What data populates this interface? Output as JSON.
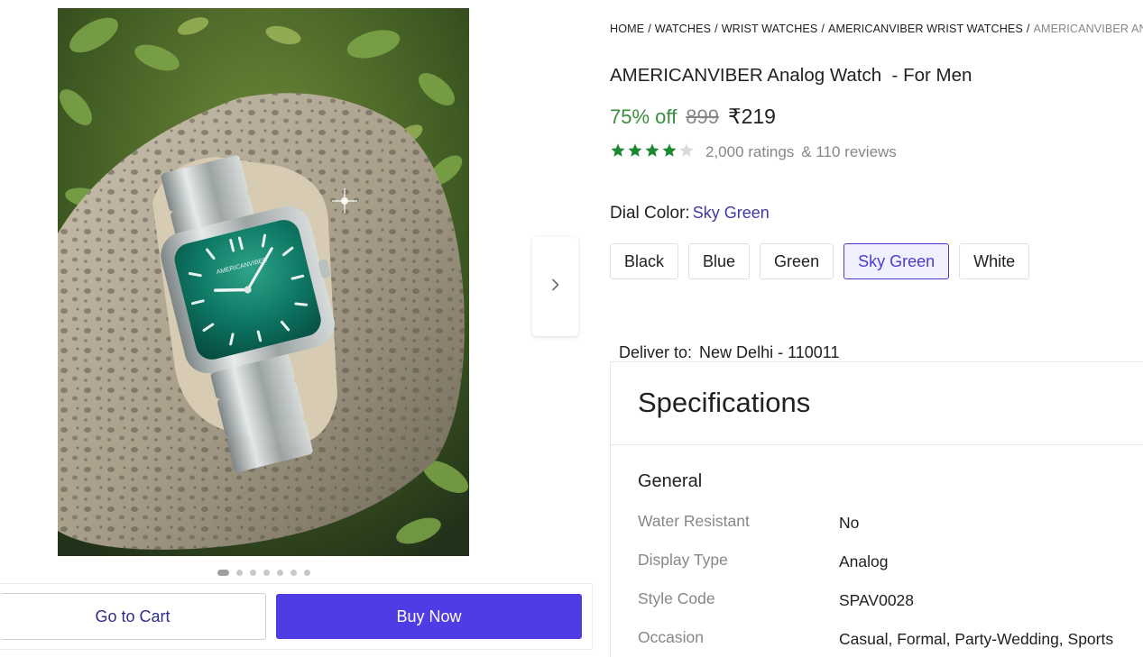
{
  "breadcrumb": [
    "HOME",
    "WATCHES",
    "WRIST WATCHES",
    "AMERICANVIBER WRIST WATCHES",
    "AMERICANVIBER ANALOG WATCH - FOR MEN"
  ],
  "product": {
    "title": "AMERICANVIBER Analog Watch  - For Men",
    "image_brand_text": "AMERICANVIBER",
    "discount": "75% off",
    "mrp": "899",
    "price": "₹219",
    "rating_stars": 4,
    "ratings_text": "2,000 ratings",
    "reviews_text": "& 110 reviews"
  },
  "dial_color": {
    "label": "Dial Color:",
    "selected": "Sky Green",
    "options": [
      "Black",
      "Blue",
      "Green",
      "Sky Green",
      "White"
    ]
  },
  "delivery": {
    "label": "Deliver to:",
    "location": "New Delhi - 110011"
  },
  "specifications": {
    "title": "Specifications",
    "group": "General",
    "rows": [
      {
        "key": "Water Resistant",
        "value": "No"
      },
      {
        "key": "Display Type",
        "value": "Analog"
      },
      {
        "key": "Style Code",
        "value": "SPAV0028"
      },
      {
        "key": "Occasion",
        "value": "Casual, Formal, Party-Wedding, Sports"
      }
    ]
  },
  "gallery": {
    "total_images": 7,
    "active_index": 0
  },
  "actions": {
    "cart_label": "Go to Cart",
    "buy_label": "Buy Now"
  },
  "icons": {
    "next": "chevron-right-icon",
    "star": "star-icon"
  },
  "colors": {
    "accent": "#4f3ce4",
    "discount_green": "#388e3c",
    "star_green": "#1b8a2f",
    "selected_text": "#4b3bd6"
  }
}
